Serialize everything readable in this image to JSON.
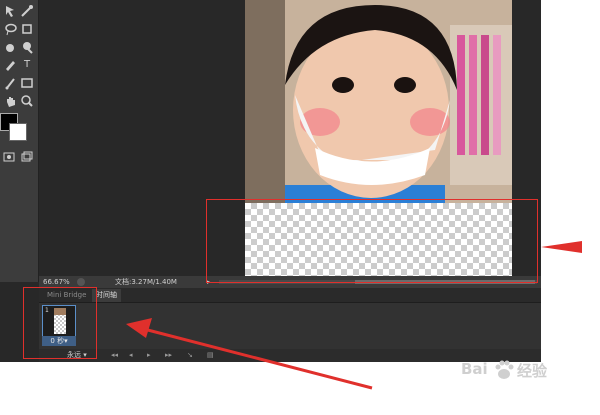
{
  "document": {
    "zoom": "66.67%",
    "doc_info": "文档:3.27M/1.40M",
    "play_arrow": "▸"
  },
  "panel": {
    "tabs": [
      {
        "label": "Mini Bridge",
        "active": false
      },
      {
        "label": "时间轴",
        "active": true
      }
    ],
    "frame": {
      "number": "1",
      "delay": "0 秒▾"
    },
    "loop_option": "永远 ▾",
    "controls": [
      "◂◂",
      "◂",
      "▸",
      "▸▸",
      "↘",
      "▤"
    ]
  },
  "tools": [
    "move-icon",
    "lasso-icon",
    "quick-select-icon",
    "crop-icon",
    "eyedropper-icon",
    "healing-brush-icon",
    "brush-icon",
    "clone-stamp-icon",
    "eraser-icon",
    "gradient-icon",
    "dodge-icon",
    "pen-icon",
    "type-icon",
    "path-select-icon",
    "rectangle-icon",
    "hand-icon",
    "zoom-icon"
  ],
  "tool_glyphs": {
    "type": "T"
  },
  "colors": {
    "highlight": "#e0302c",
    "foreground": "#000000",
    "background": "#ffffff"
  },
  "watermark": {
    "brand": "Bai",
    "brand_suffix": "经验"
  }
}
